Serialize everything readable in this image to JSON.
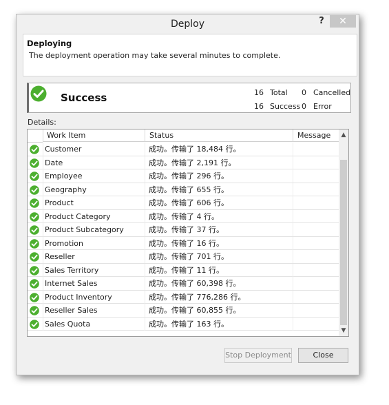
{
  "window": {
    "title": "Deploy",
    "help_label": "?",
    "close_label": "✕"
  },
  "header": {
    "title": "Deploying",
    "subtitle": "The deployment operation may take several minutes to complete."
  },
  "result": {
    "label": "Success",
    "stats": {
      "total_value": "16",
      "total_label": "Total",
      "cancelled_value": "0",
      "cancelled_label": "Cancelled",
      "success_value": "16",
      "success_label": "Success",
      "error_value": "0",
      "error_label": "Error"
    }
  },
  "details": {
    "label": "Details:",
    "columns": {
      "work_item": "Work Item",
      "status": "Status",
      "message": "Message"
    },
    "rows": [
      {
        "item": "Customer",
        "status": "成功。传输了 18,484 行。",
        "message": ""
      },
      {
        "item": "Date",
        "status": "成功。传输了 2,191 行。",
        "message": ""
      },
      {
        "item": "Employee",
        "status": "成功。传输了 296 行。",
        "message": ""
      },
      {
        "item": "Geography",
        "status": "成功。传输了 655 行。",
        "message": ""
      },
      {
        "item": "Product",
        "status": "成功。传输了 606 行。",
        "message": ""
      },
      {
        "item": "Product Category",
        "status": "成功。传输了 4 行。",
        "message": ""
      },
      {
        "item": "Product Subcategory",
        "status": "成功。传输了 37 行。",
        "message": ""
      },
      {
        "item": "Promotion",
        "status": "成功。传输了 16 行。",
        "message": ""
      },
      {
        "item": "Reseller",
        "status": "成功。传输了 701 行。",
        "message": ""
      },
      {
        "item": "Sales Territory",
        "status": "成功。传输了 11 行。",
        "message": ""
      },
      {
        "item": "Internet Sales",
        "status": "成功。传输了 60,398 行。",
        "message": ""
      },
      {
        "item": "Product Inventory",
        "status": "成功。传输了 776,286 行。",
        "message": ""
      },
      {
        "item": "Reseller Sales",
        "status": "成功。传输了 60,855 行。",
        "message": ""
      },
      {
        "item": "Sales Quota",
        "status": "成功。传输了 163 行。",
        "message": ""
      }
    ]
  },
  "buttons": {
    "stop": "Stop Deployment",
    "close": "Close"
  },
  "colors": {
    "success_green": "#4caf2f",
    "dialog_bg": "#f0f0f0"
  }
}
